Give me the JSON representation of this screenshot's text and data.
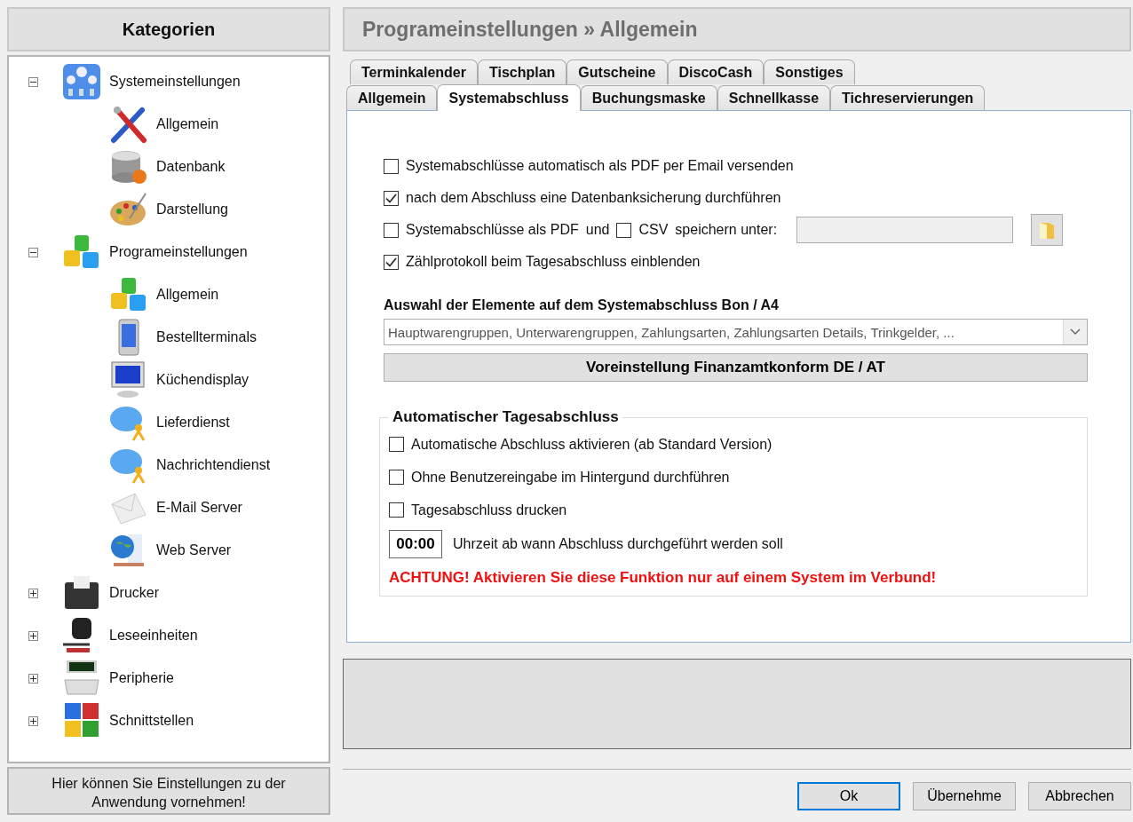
{
  "sidebar": {
    "title": "Kategorien",
    "tree": [
      {
        "label": "Systemeinstellungen",
        "expanded": true,
        "children": [
          {
            "label": "Allgemein"
          },
          {
            "label": "Datenbank"
          },
          {
            "label": "Darstellung"
          }
        ]
      },
      {
        "label": "Programeinstellungen",
        "expanded": true,
        "children": [
          {
            "label": "Allgemein"
          },
          {
            "label": "Bestellterminals"
          },
          {
            "label": "Küchendisplay"
          },
          {
            "label": "Lieferdienst"
          },
          {
            "label": "Nachrichtendienst"
          },
          {
            "label": "E-Mail Server"
          },
          {
            "label": "Web Server"
          }
        ]
      },
      {
        "label": "Drucker",
        "expanded": false
      },
      {
        "label": "Leseeinheiten",
        "expanded": false
      },
      {
        "label": "Peripherie",
        "expanded": false
      },
      {
        "label": "Schnittstellen",
        "expanded": false
      }
    ],
    "hint": "Hier können Sie Einstellungen zu der Anwendung vornehmen!"
  },
  "header": {
    "title": "Programeinstellungen » Allgemein"
  },
  "tab_rows": [
    [
      {
        "label": "Terminkalender",
        "selected": false
      },
      {
        "label": "Tischplan",
        "selected": false
      },
      {
        "label": "Gutscheine",
        "selected": false
      },
      {
        "label": "DiscoCash",
        "selected": false
      },
      {
        "label": "Sonstiges",
        "selected": false
      }
    ],
    [
      {
        "label": "Allgemein",
        "selected": false
      },
      {
        "label": "Systemabschluss",
        "selected": true
      },
      {
        "label": "Buchungsmaske",
        "selected": false
      },
      {
        "label": "Schnellkasse",
        "selected": false
      },
      {
        "label": "Tichreservierungen",
        "selected": false
      }
    ]
  ],
  "options": [
    {
      "kind": "check",
      "label": "Systemabschlüsse automatisch als PDF per Email versenden",
      "checked": false
    },
    {
      "kind": "check",
      "label": "nach dem Abschluss eine Datenbanksicherung durchführen",
      "checked": true
    },
    {
      "kind": "save",
      "pdf": {
        "label": "Systemabschlüsse als PDF",
        "checked": false
      },
      "conjunction": "und",
      "csv": {
        "label": "CSV",
        "checked": false
      },
      "label": "speichern unter:"
    },
    {
      "kind": "check",
      "label": "Zählprotokoll beim Tagesabschluss einblenden",
      "checked": true
    }
  ],
  "elements": {
    "title": "Auswahl der Elemente auf dem Systemabschluss Bon / A4",
    "value": "Hauptwarengruppen, Unterwarengruppen, Zahlungsarten, Zahlungsarten Details, Trinkgelder, ...",
    "preset_button": "Voreinstellung Finanzamtkonform DE / AT"
  },
  "auto_close": {
    "title": "Automatischer Tagesabschluss",
    "options": [
      {
        "label": "Automatische Abschluss aktivieren (ab Standard Version)",
        "checked": false
      },
      {
        "label": "Ohne Benutzereingabe im Hintergund durchführen",
        "checked": false
      },
      {
        "label": "Tagesabschluss drucken",
        "checked": false
      }
    ],
    "time": "00:00",
    "time_label": "Uhrzeit ab wann Abschluss durchgeführt werden soll",
    "warning": "ACHTUNG! Aktivieren Sie diese Funktion nur auf einem System im Verbund!"
  },
  "buttons": [
    {
      "label": "Ok",
      "default": true
    },
    {
      "label": "Übernehme",
      "default": false
    },
    {
      "label": "Abbrechen",
      "default": false
    }
  ]
}
